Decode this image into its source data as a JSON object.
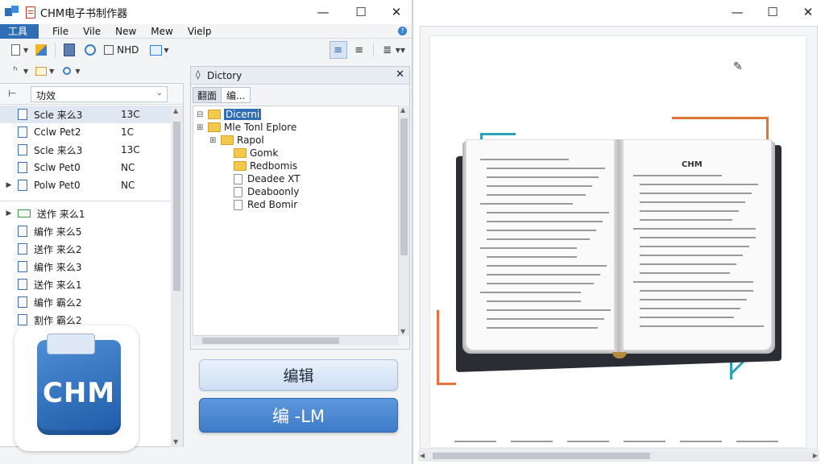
{
  "left_window": {
    "title": "CHM电子书制作器",
    "controls": {
      "minimize": "—",
      "maximize": "☐",
      "close": "✕"
    },
    "menu": [
      {
        "label": "工具",
        "active": true
      },
      {
        "label": "File",
        "active": false
      },
      {
        "label": "Vile",
        "active": false
      },
      {
        "label": "New",
        "active": false
      },
      {
        "label": "Mew",
        "active": false
      },
      {
        "label": "Vielp",
        "active": false
      }
    ],
    "toolbar_text": "NHD",
    "left_pane": {
      "dropdown_value": "功效",
      "group1": [
        {
          "label": "Scle 来么3",
          "value": "13C"
        },
        {
          "label": "Cclw Pet2",
          "value": "1C"
        },
        {
          "label": "Scle 来么3",
          "value": "13C"
        },
        {
          "label": "Sclw Pet0",
          "value": "NC"
        },
        {
          "label": "Polw Pet0",
          "value": "NC"
        }
      ],
      "group2": [
        {
          "label": "送作 来么1"
        },
        {
          "label": "编作 来么5"
        },
        {
          "label": "送作 来么2"
        },
        {
          "label": "编作 来么3"
        },
        {
          "label": "送作 来么1"
        },
        {
          "label": "编作 霸么2"
        },
        {
          "label": "割作 霸么2"
        }
      ]
    },
    "directory": {
      "title": "Dictory",
      "tabs": [
        "翻面",
        "编..."
      ],
      "tree": [
        {
          "label": "Dicerni",
          "level": 0,
          "type": "folder",
          "selected": true
        },
        {
          "label": "Mle Tonl Eplore",
          "level": 0,
          "type": "folder"
        },
        {
          "label": "Rapol",
          "level": 1,
          "type": "folder"
        },
        {
          "label": "Gomk",
          "level": 2,
          "type": "folder"
        },
        {
          "label": "Redbomis",
          "level": 2,
          "type": "folder"
        },
        {
          "label": "Deadee XT",
          "level": 2,
          "type": "file"
        },
        {
          "label": "Deaboonly",
          "level": 2,
          "type": "file"
        },
        {
          "label": "Red Bomir",
          "level": 2,
          "type": "file"
        }
      ]
    },
    "buttons": {
      "edit": "编辑",
      "build": "编 -LM"
    },
    "logo_text": "CHM"
  },
  "right_window": {
    "book_page_heading": "CHM",
    "colors": {
      "accent_blue": "#2f6db5",
      "orange": "#e4733a",
      "teal": "#2ba4b6",
      "yellow": "#e8c93a"
    }
  }
}
